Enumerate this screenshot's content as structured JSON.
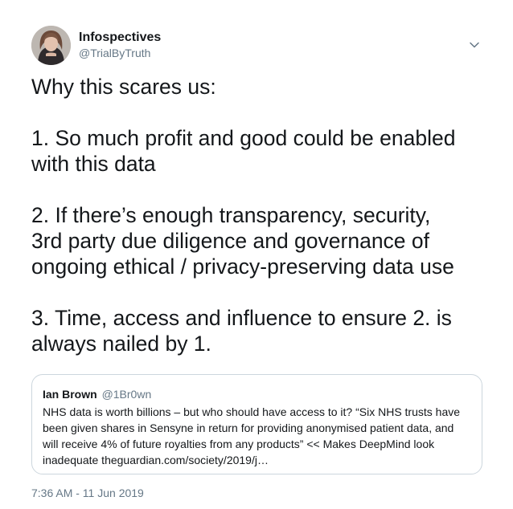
{
  "author": {
    "display_name": "Infospectives",
    "handle": "@TrialByTruth",
    "avatar_icon": "avatar-photo"
  },
  "menu": {
    "icon": "chevron-down-icon"
  },
  "tweet": {
    "paragraphs": [
      [
        "Why this scares us:"
      ],
      [
        "1. So much profit and good could be enabled",
        "with this data"
      ],
      [
        "2. If there’s enough transparency, security,",
        "3rd party due diligence and governance of",
        "ongoing ethical / privacy-preserving data use"
      ],
      [
        "3. Time, access and influence to ensure 2. is",
        "always nailed by 1."
      ]
    ]
  },
  "quoted_tweet": {
    "display_name": "Ian Brown",
    "handle": "@1Br0wn",
    "lines": [
      "NHS data is worth billions – but who should have access to it? “Six NHS trusts have",
      "been given shares in Sensyne in return for providing anonymised patient data, and",
      "will receive 4% of future royalties from any products” << Makes DeepMind look",
      "inadequate theguardian.com/society/2019/j…"
    ]
  },
  "timestamp": "7:36 AM - 11 Jun 2019",
  "colors": {
    "text": "#14171a",
    "secondary": "#657786",
    "border": "#ccd6dd"
  }
}
